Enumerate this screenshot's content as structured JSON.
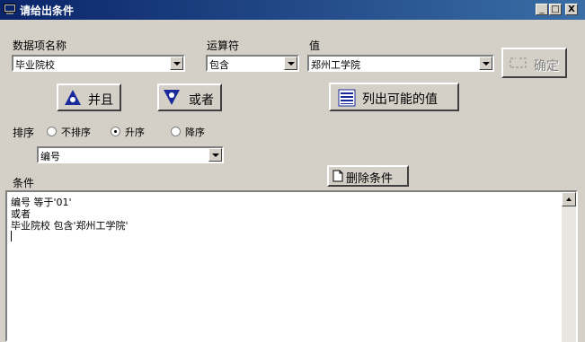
{
  "window": {
    "title": "请给出条件",
    "minimize": "_",
    "maximize": "□",
    "close": "X"
  },
  "fields": {
    "item_label": "数据项名称",
    "operator_label": "运算符",
    "value_label": "值",
    "item_value": "毕业院校",
    "operator_value": "包含",
    "value_value": "郑州工学院"
  },
  "buttons": {
    "confirm": "确定",
    "and": "并且",
    "or": "或者",
    "list_values": "列出可能的值",
    "delete_condition": "删除条件"
  },
  "sort": {
    "label": "排序",
    "options": [
      "不排序",
      "升序",
      "降序"
    ],
    "selected": "升序",
    "field_value": "编号"
  },
  "conditions": {
    "label": "条件",
    "lines": [
      "编号 等于'01'",
      "或者",
      "毕业院校 包含'郑州工学院'"
    ]
  },
  "colors": {
    "titlebar_start": "#0a246a",
    "titlebar_end": "#3a6ea5",
    "face": "#d4d0c8",
    "icon_blue": "#1a2a9a"
  }
}
